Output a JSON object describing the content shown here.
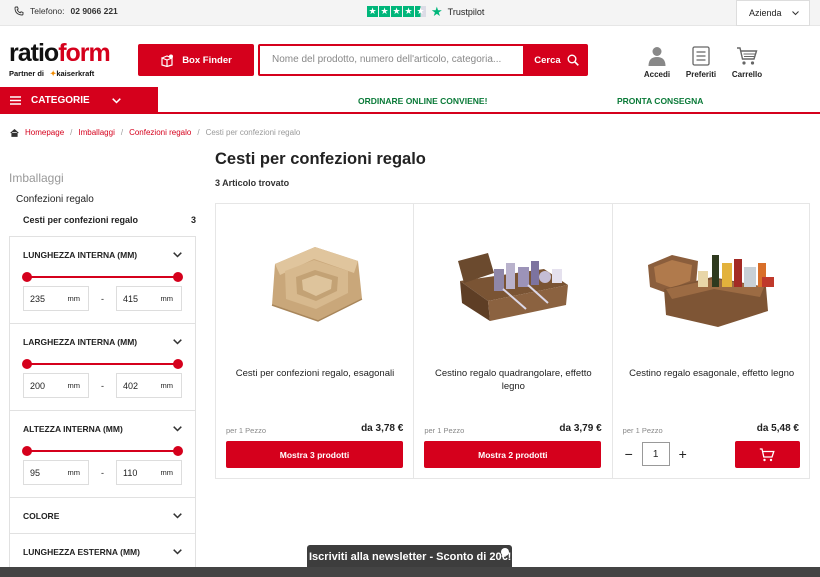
{
  "topbar": {
    "phone_label": "Telefono:",
    "phone_number": "02 9066 221",
    "trustpilot": "Trustpilot",
    "azienda": "Azienda"
  },
  "header": {
    "logo_ratio": "ratio",
    "logo_form": "form",
    "partner_label": "Partner di",
    "partner_brand": "kaiserkraft",
    "box_finder": "Box Finder",
    "search_placeholder": "Nome del prodotto, numero dell'articolo, categoria...",
    "search_button": "Cerca",
    "icons": [
      {
        "label": "Accedi",
        "icon": "user-icon"
      },
      {
        "label": "Preferiti",
        "icon": "favorites-list-icon"
      },
      {
        "label": "Carrello",
        "icon": "cart-icon"
      }
    ]
  },
  "nav": {
    "categorie": "CATEGORIE",
    "links": [
      "ORDINARE ONLINE CONVIENE!",
      "PRONTA CONSEGNA"
    ]
  },
  "breadcrumb": [
    "Homepage",
    "Imballaggi",
    "Confezioni regalo",
    "Cesti per confezioni regalo"
  ],
  "sidebar": {
    "title": "Imballaggi",
    "subtitle": "Confezioni regalo",
    "category": {
      "label": "Cesti per confezioni regalo",
      "count": "3"
    },
    "filters": [
      {
        "label": "LUNGHEZZA INTERNA (MM)",
        "min": "235",
        "max": "415",
        "unit": "mm"
      },
      {
        "label": "LARGHEZZA INTERNA (MM)",
        "min": "200",
        "max": "402",
        "unit": "mm"
      },
      {
        "label": "ALTEZZA INTERNA (MM)",
        "min": "95",
        "max": "110",
        "unit": "mm"
      },
      {
        "label": "COLORE"
      },
      {
        "label": "LUNGHEZZA ESTERNA (MM)"
      }
    ]
  },
  "main": {
    "title": "Cesti per confezioni regalo",
    "count": "3 Articolo trovato",
    "products": [
      {
        "name": "Cesti per confezioni regalo, esagonali",
        "per": "per 1 Pezzo",
        "price": "da 3,78 €",
        "cta": "Mostra 3 prodotti"
      },
      {
        "name": "Cestino regalo quadrangolare, effetto legno",
        "per": "per 1 Pezzo",
        "price": "da 3,79 €",
        "cta": "Mostra 2 prodotti"
      },
      {
        "name": "Cestino regalo esagonale, effetto legno",
        "per": "per 1 Pezzo",
        "price": "da 5,48 €",
        "quantity": "1"
      }
    ]
  },
  "newsletter": "Iscriviti alla newsletter - Sconto di 20€!",
  "colors": {
    "accent": "#d5001c",
    "green": "#0a7a38",
    "trustpilot": "#00b67a"
  }
}
